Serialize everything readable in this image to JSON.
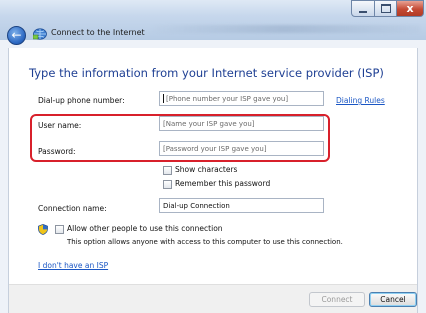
{
  "window": {
    "title": "Connect to the Internet",
    "close_glyph": "x"
  },
  "main": {
    "heading": "Type the information from your Internet service provider (ISP)",
    "dialup": {
      "label": "Dial-up phone number:",
      "placeholder": "[Phone number your ISP gave you]",
      "rules_link": "Dialing Rules"
    },
    "username": {
      "label": "User name:",
      "placeholder": "[Name your ISP gave you]"
    },
    "password": {
      "label": "Password:",
      "placeholder": "[Password your ISP gave you]"
    },
    "show_characters": {
      "label": "Show characters",
      "checked": false
    },
    "remember_password": {
      "label": "Remember this password",
      "checked": false
    },
    "connection_name": {
      "label": "Connection name:",
      "value": "Dial-up Connection"
    },
    "allow_others": {
      "label": "Allow other people to use this connection",
      "checked": false,
      "description": "This option allows anyone with access to this computer to use this connection."
    },
    "no_isp_link": "I don't have an ISP"
  },
  "footer": {
    "connect_label": "Connect",
    "cancel_label": "Cancel"
  },
  "icons": {
    "back": "back-arrow-icon",
    "network": "network-connection-icon",
    "shield": "uac-shield-icon"
  },
  "colors": {
    "heading": "#1e3f93",
    "link": "#1a56c4",
    "highlight": "#d8202b",
    "close_button": "#c54a34"
  }
}
